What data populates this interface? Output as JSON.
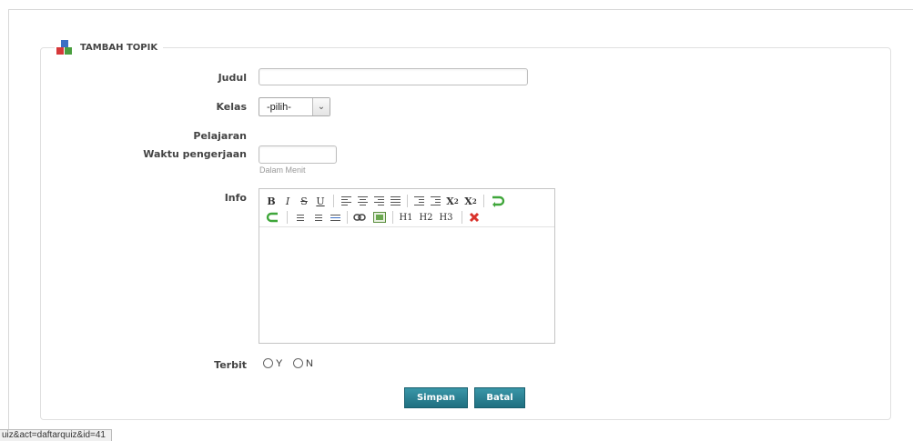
{
  "form": {
    "title": "TAMBAH TOPIK",
    "fields": {
      "judul_label": "Judul",
      "judul_value": "",
      "kelas_label": "Kelas",
      "kelas_selected": "-pilih-",
      "pelajaran_label": "Pelajaran",
      "waktu_label": "Waktu pengerjaan",
      "waktu_value": "",
      "waktu_hint": "Dalam Menit",
      "info_label": "Info",
      "terbit_label": "Terbit",
      "terbit_options": [
        "Y",
        "N"
      ]
    },
    "buttons": {
      "save": "Simpan",
      "cancel": "Batal"
    }
  },
  "editor": {
    "toolbar": {
      "bold": "B",
      "italic": "I",
      "strike": "S",
      "underline": "U",
      "subscript": "X",
      "sub_mark": "2",
      "superscript": "X",
      "sup_mark": "2",
      "h1": "H1",
      "h2": "H2",
      "h3": "H3"
    },
    "content": ""
  },
  "status_bar": {
    "url": "uiz&act=daftarquiz&id=41"
  },
  "colors": {
    "button": "#2a8193",
    "remove_icon": "#d9322b",
    "undo_icon": "#3fa63a",
    "hint": "#999999"
  }
}
